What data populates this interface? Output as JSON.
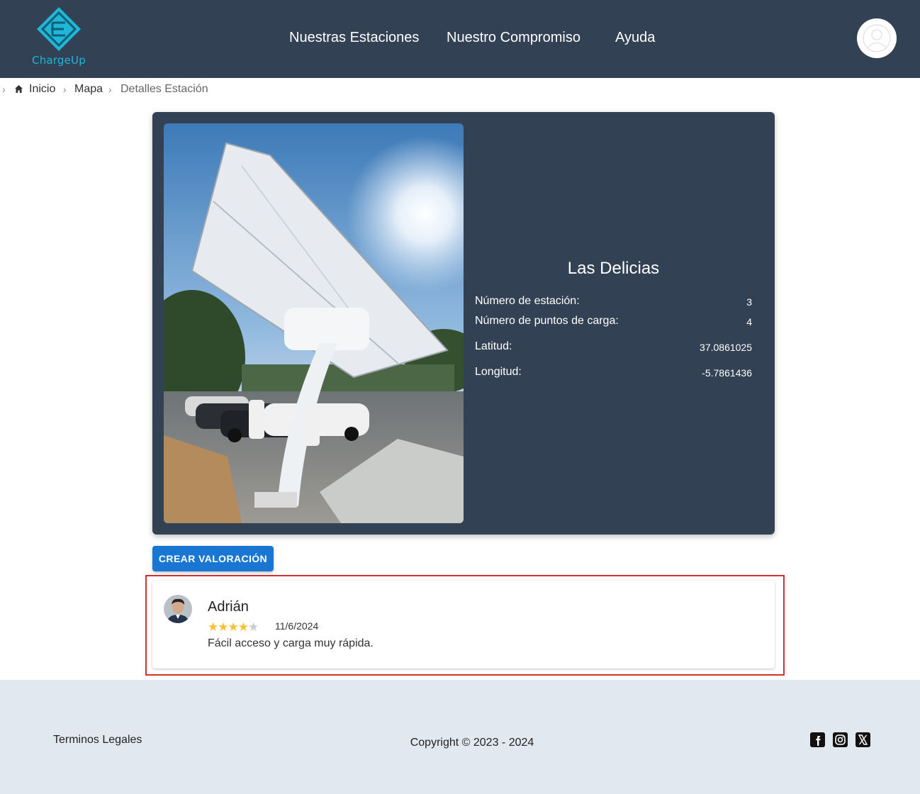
{
  "header": {
    "logo_text": "ChargeUp",
    "nav": [
      "Nuestras Estaciones",
      "Nuestro Compromiso",
      "Ayuda"
    ],
    "profile_icon": "user-avatar-icon"
  },
  "breadcrumb": {
    "home_icon": "home-icon",
    "items": [
      "Inicio",
      "Mapa",
      "Detalles Estación"
    ]
  },
  "station": {
    "name": "Las Delicias",
    "details": [
      {
        "label": "Número de estación:",
        "value": "3"
      },
      {
        "label": "Número de puntos de carga:",
        "value": "4"
      },
      {
        "label": "Latitud:",
        "value": "37.0861025"
      },
      {
        "label": "Longitud:",
        "value": "-5.7861436"
      }
    ]
  },
  "actions": {
    "create_review": "CREAR VALORACIÓN"
  },
  "reviews": [
    {
      "author": "Adrián",
      "rating": 4,
      "max_rating": 5,
      "date": "11/6/2024",
      "text": "Fácil acceso y carga muy rápida."
    }
  ],
  "footer": {
    "legal": "Terminos Legales",
    "copyright": "Copyright © 2023 - 2024",
    "social": [
      "facebook-icon",
      "instagram-icon",
      "x-icon"
    ]
  },
  "colors": {
    "header_bg": "#334155",
    "accent": "#1976d2",
    "logo": "#1fb6d8",
    "footer_bg": "#e2e8f0",
    "highlight": "#d32f2f"
  }
}
